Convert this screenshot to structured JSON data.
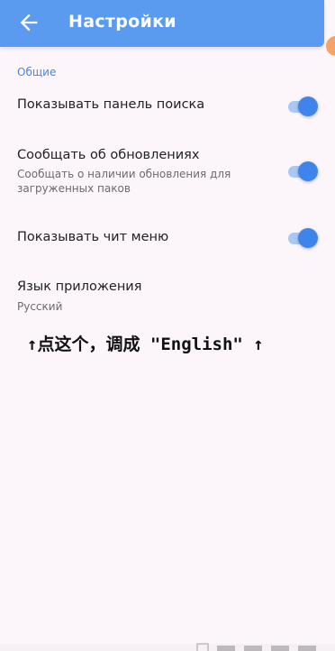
{
  "appbar": {
    "title": "Настройки",
    "back_icon": "arrow-left-icon",
    "color": "#5a9bef"
  },
  "settings": {
    "section_header": "Общие",
    "items": [
      {
        "title": "Показывать панель поиска",
        "subtitle": "",
        "toggle_on": true
      },
      {
        "title": "Сообщать об обновлениях",
        "subtitle": "Сообщать о наличии обновления для загруженных паков",
        "toggle_on": true
      },
      {
        "title": "Показывать чит меню",
        "subtitle": "",
        "toggle_on": true
      },
      {
        "title": "Язык приложения",
        "subtitle": "Русский"
      }
    ]
  },
  "annotation": {
    "text": "↑点这个，调成 \"English\" ↑"
  },
  "colors": {
    "accent": "#3f84ea",
    "background": "#fcf6fb"
  }
}
